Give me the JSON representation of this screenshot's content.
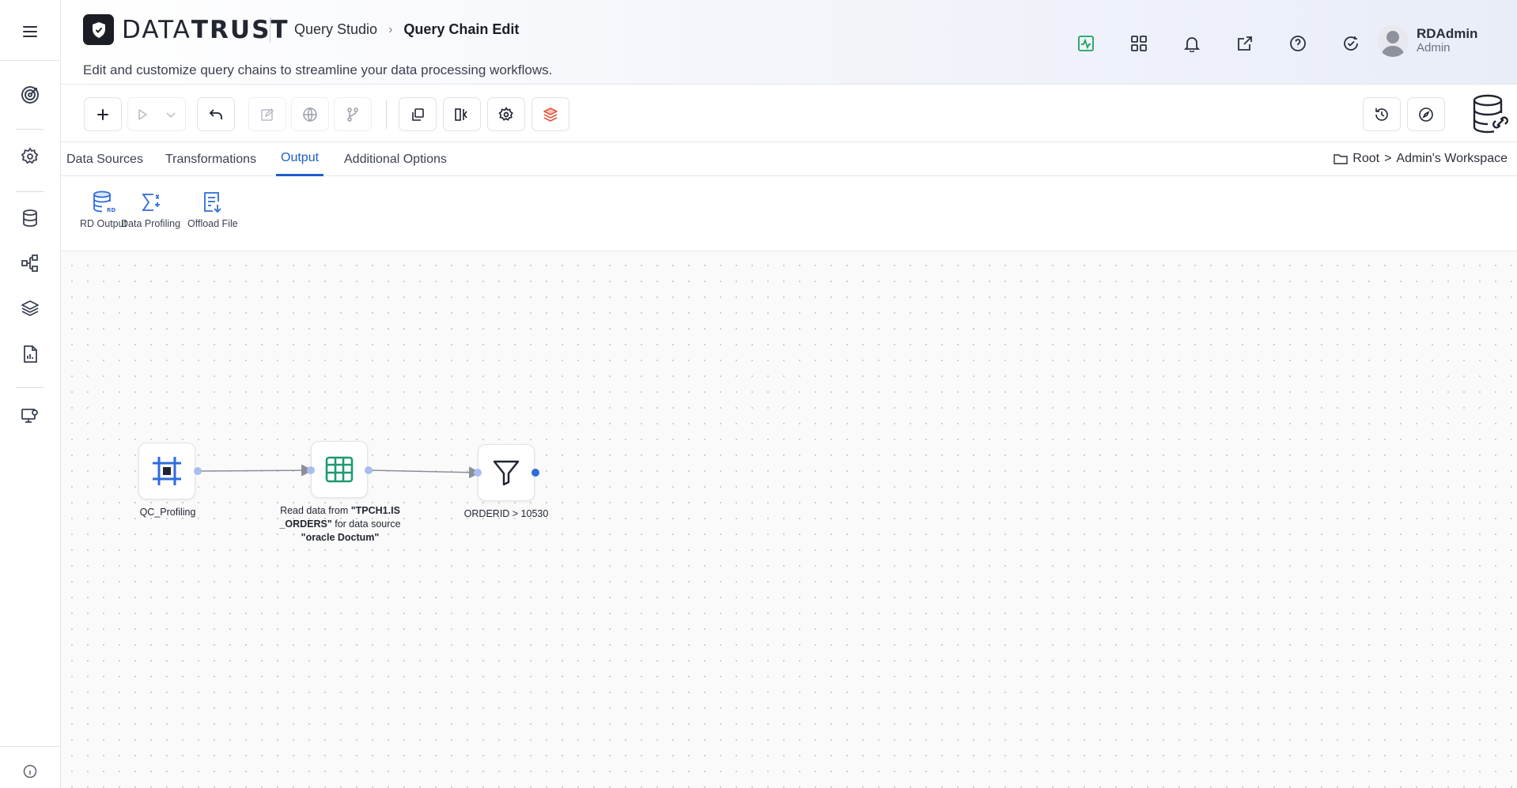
{
  "header": {
    "logo_text_light": "DATA",
    "logo_text_bold": "TRUST",
    "breadcrumb_root": "Query Studio",
    "breadcrumb_current": "Query Chain Edit",
    "subtitle": "Edit and customize query chains to streamline your data processing workflows.",
    "icons": [
      "activity-icon",
      "apps-grid-icon",
      "bell-icon",
      "external-link-icon",
      "help-icon",
      "refresh-check-icon"
    ],
    "user": {
      "name": "RDAdmin",
      "role": "Admin"
    }
  },
  "sidebar": {
    "items": [
      "menu-icon",
      "target-icon",
      "settings-icon",
      "database-icon",
      "flow-icon",
      "layers-icon",
      "report-icon",
      "monitor-settings-icon",
      "info-icon"
    ]
  },
  "toolbar": {
    "buttons": [
      "add",
      "run",
      "run-options",
      "undo",
      "edit",
      "globe",
      "branch",
      "duplicate",
      "split-view",
      "settings",
      "layers-stack",
      "history",
      "compass",
      "database-link"
    ]
  },
  "tabs": [
    {
      "label": "Data Sources",
      "active": false
    },
    {
      "label": "Transformations",
      "active": false
    },
    {
      "label": "Output",
      "active": true
    },
    {
      "label": "Additional Options",
      "active": false
    }
  ],
  "workspace_path": {
    "root": "Root",
    "separator": ">",
    "current": "Admin's Workspace"
  },
  "palette": [
    {
      "label": "RD Output",
      "icon": "database-output-icon"
    },
    {
      "label": "Data Profiling",
      "icon": "sigma-profiling-icon"
    },
    {
      "label": "Offload File",
      "icon": "file-download-icon"
    }
  ],
  "flow": {
    "nodes": [
      {
        "id": "qc",
        "label": "QC_Profiling",
        "icon": "frame-icon"
      },
      {
        "id": "read",
        "label_prefix": "Read data from ",
        "label_table": "\"TPCH1.IS _ORDERS\"",
        "label_mid": " for data source ",
        "label_source": "\"oracle Doctum\"",
        "icon": "table-icon"
      },
      {
        "id": "filter",
        "label": "ORDERID > 10530",
        "icon": "filter-icon"
      }
    ],
    "edges": [
      [
        "qc",
        "read"
      ],
      [
        "read",
        "filter"
      ]
    ]
  },
  "colors": {
    "accent": "#1d5fc9",
    "logo_bg": "#1b1e24",
    "table_icon": "#1f9a6e",
    "frame_icon": "#2f6bdc",
    "activity_icon": "#19a35a",
    "layers_icon": "#e2583e"
  }
}
